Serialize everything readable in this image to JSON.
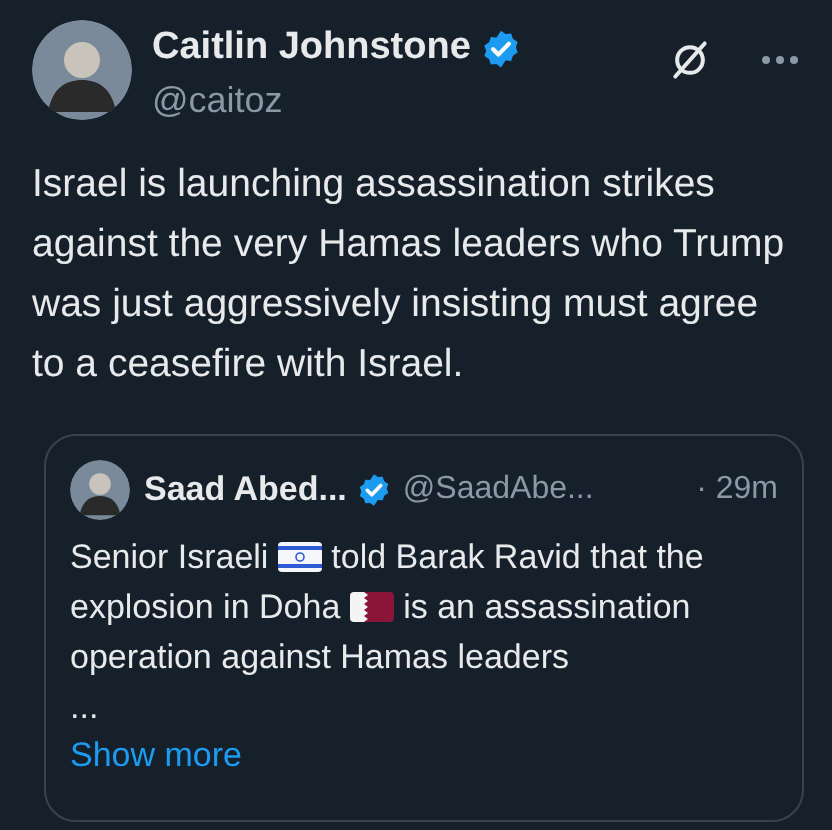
{
  "author": {
    "name": "Caitlin Johnstone",
    "handle": "@caitoz",
    "verified": true
  },
  "text": "Israel is launching assassination strikes against the very Hamas leaders who Trump was just aggressively insisting must agree to a ceasefire with Israel.",
  "quote": {
    "name": "Saad Abed...",
    "verified": true,
    "handle": "@SaadAbe...",
    "time": "· 29m",
    "body": [
      {
        "kind": "text",
        "text": "Senior Israeli "
      },
      {
        "kind": "flag_il"
      },
      {
        "kind": "text",
        "text": " told Barak Ravid that the explosion in Doha "
      },
      {
        "kind": "flag_qa"
      },
      {
        "kind": "text",
        "text": " is an assassination operation against Hamas leaders"
      }
    ],
    "ellipsis": "...",
    "show_more": "Show more"
  }
}
